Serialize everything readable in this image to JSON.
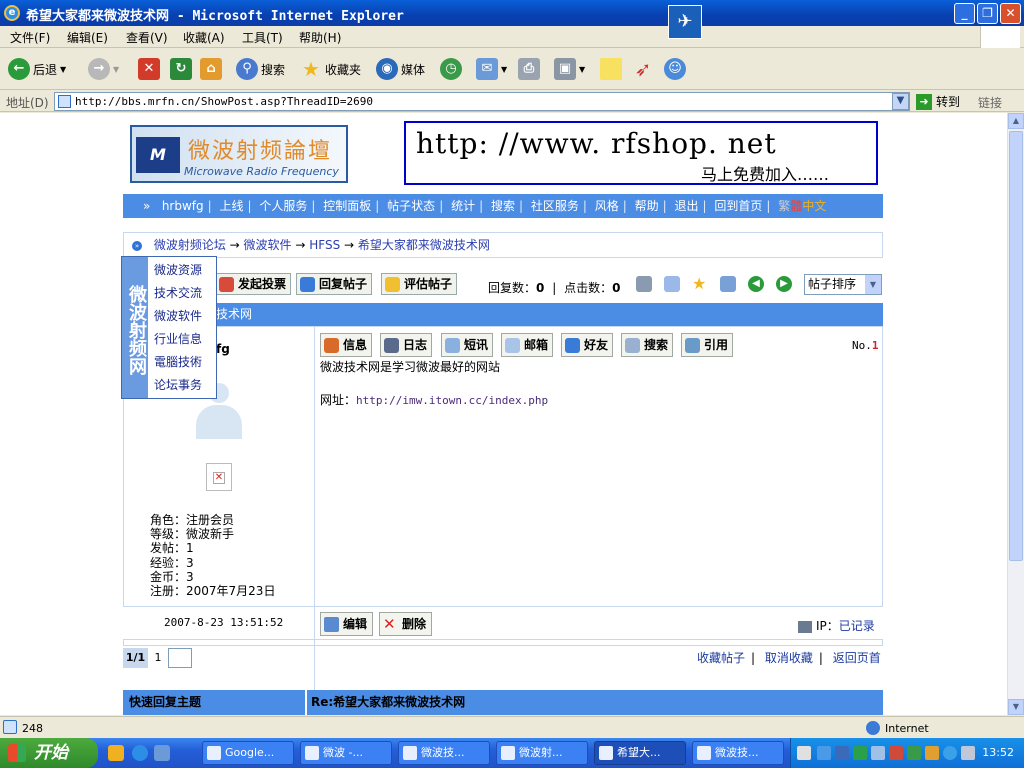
{
  "window": {
    "title": "希望大家都来微波技术网 - Microsoft Internet Explorer"
  },
  "menu": {
    "items": [
      "文件(F)",
      "编辑(E)",
      "查看(V)",
      "收藏(A)",
      "工具(T)",
      "帮助(H)"
    ]
  },
  "toolbar": {
    "back": "后退",
    "search": "搜索",
    "favorites": "收藏夹",
    "media": "媒体"
  },
  "address": {
    "label": "地址(D)",
    "url": "http://bbs.mrfn.cn/ShowPost.asp?ThreadID=2690",
    "go": "转到",
    "links": "链接"
  },
  "site": {
    "logo_cn": "微波射频論壇",
    "logo_en": "Microwave Radio Frequency",
    "banner_url": "http: //www. rfshop. net",
    "banner_join": "马上免费加入……"
  },
  "forum_nav": {
    "user": "hrbwfg",
    "items": [
      "上线",
      "个人服务",
      "控制面板",
      "帖子状态",
      "统计",
      "搜索",
      "社区服务",
      "风格",
      "帮助",
      "退出",
      "回到首页"
    ],
    "trad": "繁",
    "simp_a": "體",
    "simp_b": "中文"
  },
  "breadcrumb": [
    "微波射频论坛",
    "微波软件",
    "HFSS",
    "希望大家都来微波技术网"
  ],
  "dropmenu": {
    "side_label": "微波射频网",
    "items": [
      "微波资源",
      "技术交流",
      "微波软件",
      "行业信息",
      "電腦技術",
      "论坛事务"
    ]
  },
  "actions": {
    "new_poll": "发起投票",
    "reply": "回复帖子",
    "rate": "评估帖子"
  },
  "counts": {
    "reply_label": "回复数：",
    "reply_value": "0",
    "sep": "|",
    "click_label": "点击数：",
    "click_value": "0"
  },
  "sort": {
    "selected": "帖子排序"
  },
  "post": {
    "header_title": "技术网",
    "author": "fg",
    "buttons": [
      "信息",
      "日志",
      "短讯",
      "邮箱",
      "好友",
      "搜索",
      "引用"
    ],
    "floor_label": "No.",
    "floor_num": "1",
    "body": "微波技术网是学习微波最好的网站",
    "url_label": "网址：",
    "url": "http://imw.itown.cc/index.php",
    "user_info": [
      "角色：注册会员",
      "等级：微波新手",
      "发帖：1",
      "经验：3",
      "金币：3",
      "注册：2007年7月23日"
    ],
    "time": "2007-8-23 13:51:52",
    "edit": "编辑",
    "delete": "删除",
    "ip_label": "IP：",
    "ip_link": "已记录"
  },
  "pager": {
    "current": "1/1",
    "page": "1"
  },
  "fav_links": [
    "收藏帖子",
    "取消收藏",
    "返回页首"
  ],
  "quick_reply": {
    "left": "快速回复主题",
    "right": "Re:希望大家都来微波技术网"
  },
  "status": {
    "text": "248",
    "zone": "Internet"
  },
  "taskbar": {
    "start": "开始",
    "tasks": [
      "Google...",
      "微波 -...",
      "微波技...",
      "微波射...",
      "希望大...",
      "微波技..."
    ],
    "clock": "13:52"
  },
  "colors": {
    "nav_blue": "#4b8ce4",
    "xp_blue": "#245ed8",
    "start_green": "#2f8a2a"
  }
}
